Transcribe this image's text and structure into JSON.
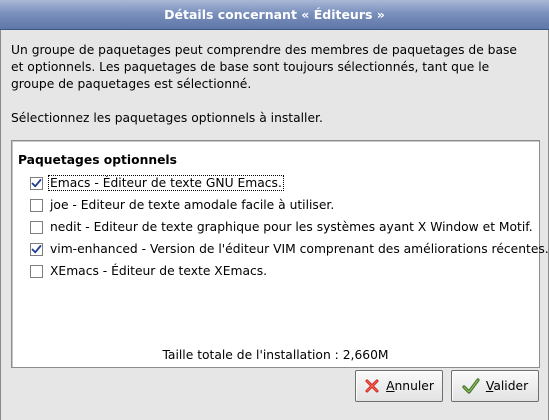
{
  "window": {
    "title": "Détails concernant « Éditeurs »"
  },
  "description": "Un groupe de paquetages peut comprendre des membres de paquetages de base et optionnels. Les paquetages de base sont toujours sélectionnés, tant que le groupe de paquetages est sélectionné.",
  "select_prompt": "Sélectionnez les paquetages optionnels à installer.",
  "packages": {
    "heading": "Paquetages optionnels",
    "items": [
      {
        "label": "Emacs - Éditeur de texte GNU Emacs.",
        "checked": true
      },
      {
        "label": "joe - Editeur de texte amodale facile à utiliser.",
        "checked": false
      },
      {
        "label": "nedit - Editeur de texte graphique pour les systèmes ayant X Window et Motif.",
        "checked": false
      },
      {
        "label": "vim-enhanced - Version de l'éditeur VIM comprenant des améliorations récentes.",
        "checked": true
      },
      {
        "label": "XEmacs - Éditeur de texte XEmacs.",
        "checked": false
      }
    ]
  },
  "total_size": "Taille totale de l'installation : 2,660M",
  "buttons": {
    "cancel": {
      "mnemonic": "A",
      "rest": "nnuler",
      "icon": "cancel-x-icon"
    },
    "ok": {
      "mnemonic": "V",
      "rest": "alider",
      "icon": "checkmark-icon"
    }
  },
  "colors": {
    "titlebar": "#7a90bd",
    "cancel_icon": "#c8261a",
    "ok_icon": "#4a7a2a"
  }
}
